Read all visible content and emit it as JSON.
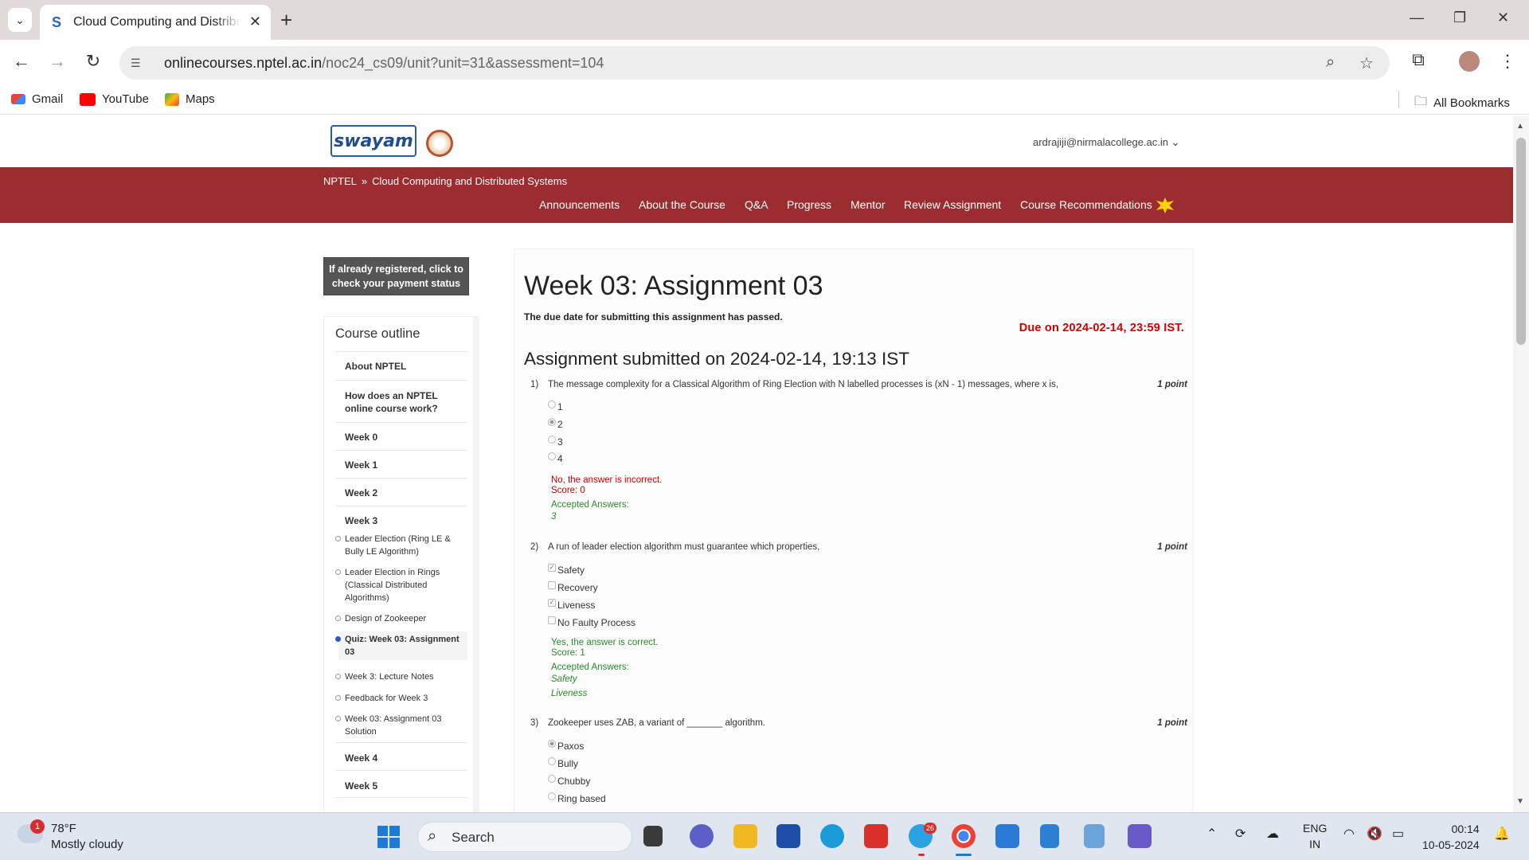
{
  "browser": {
    "tab_title": "Cloud Computing and Distributed Systems",
    "url_host": "onlinecourses.nptel.ac.in",
    "url_path": "/noc24_cs09/unit?unit=31&assessment=104",
    "bookmarks": [
      "Gmail",
      "YouTube",
      "Maps"
    ],
    "all_bookmarks": "All Bookmarks"
  },
  "site": {
    "logo_text": "swayam",
    "user_email": "ardrajiji@nirmalacollege.ac.in",
    "breadcrumb": [
      "NPTEL",
      "Cloud Computing and Distributed Systems"
    ],
    "breadcrumb_sep": "»",
    "menu": [
      "Announcements",
      "About the Course",
      "Q&A",
      "Progress",
      "Mentor",
      "Review Assignment",
      "Course Recommendations"
    ],
    "payment_button": "If already registered, click to check your payment status"
  },
  "outline": {
    "title": "Course outline",
    "items": [
      "About NPTEL",
      "How does an NPTEL online course work?",
      "Week 0",
      "Week 1",
      "Week 2",
      "Week 3"
    ],
    "week3_units": [
      "Leader Election (Ring LE & Bully LE Algorithm)",
      "Leader Election in Rings (Classical Distributed Algorithms)",
      "Design of Zookeeper",
      "Quiz: Week 03: Assignment 03",
      "Week 3: Lecture Notes",
      "Feedback for Week 3",
      "Week 03: Assignment 03 Solution"
    ],
    "later_items": [
      "Week 4",
      "Week 5"
    ]
  },
  "assignment": {
    "title": "Week 03: Assignment 03",
    "due_passed": "The due date for submitting this assignment has passed.",
    "due_on": "Due on 2024-02-14, 23:59 IST.",
    "submitted": "Assignment submitted on 2024-02-14, 19:13 IST",
    "questions": [
      {
        "num": "1)",
        "text": "The message complexity for a Classical Algorithm of Ring Election with N labelled processes is (xN - 1) messages, where x is,",
        "points": "1 point",
        "options": [
          "1",
          "2",
          "3",
          "4"
        ],
        "feedback": "No, the answer is incorrect.",
        "score": "Score: 0",
        "accepted_label": "Accepted Answers:",
        "accepted": [
          "3"
        ]
      },
      {
        "num": "2)",
        "text": "A run of leader election algorithm must guarantee which properties,",
        "points": "1 point",
        "options": [
          "Safety",
          "Recovery",
          "Liveness",
          "No Faulty Process"
        ],
        "feedback": "Yes, the answer is correct.",
        "score": "Score: 1",
        "accepted_label": "Accepted Answers:",
        "accepted": [
          "Safety",
          "Liveness"
        ]
      },
      {
        "num": "3)",
        "text": "Zookeeper uses ZAB, a variant of _______ algorithm.",
        "points": "1 point",
        "options": [
          "Paxos",
          "Bully",
          "Chubby",
          "Ring based"
        ]
      }
    ]
  },
  "taskbar": {
    "temp": "78°F",
    "weather": "Mostly cloudy",
    "weather_badge": "1",
    "search": "Search",
    "lang": "ENG",
    "region": "IN",
    "time": "00:14",
    "date": "10-05-2024",
    "telegram_badge": "26"
  }
}
